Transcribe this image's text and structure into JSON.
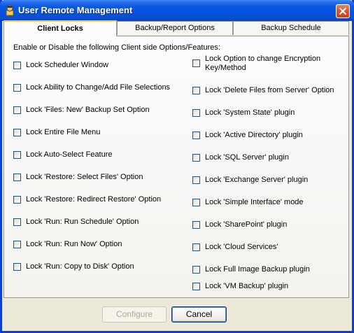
{
  "window": {
    "title": "User Remote Management",
    "app_icon": "app-icon",
    "close_icon": "close-icon"
  },
  "tabs": [
    {
      "label": "Client Locks",
      "active": true
    },
    {
      "label": "Backup/Report Options",
      "active": false
    },
    {
      "label": "Backup Schedule",
      "active": false
    }
  ],
  "panel": {
    "intro": "Enable or Disable the following Client side Options/Features:",
    "left_options": [
      {
        "label": "Lock Scheduler Window",
        "checked": false
      },
      {
        "label": "Lock Ability to Change/Add File Selections",
        "checked": false
      },
      {
        "label": "Lock 'Files: New' Backup Set Option",
        "checked": false
      },
      {
        "label": "Lock Entire File Menu",
        "checked": false
      },
      {
        "label": "Lock Auto-Select Feature",
        "checked": false
      },
      {
        "label": "Lock 'Restore: Select Files' Option",
        "checked": false
      },
      {
        "label": "Lock 'Restore: Redirect Restore' Option",
        "checked": false
      },
      {
        "label": "Lock 'Run: Run Schedule' Option",
        "checked": false
      },
      {
        "label": "Lock 'Run: Run Now' Option",
        "checked": false
      },
      {
        "label": "Lock 'Run: Copy to Disk' Option",
        "checked": false
      }
    ],
    "right_options": [
      {
        "label": "Lock Option to change Encryption",
        "label2": "Key/Method",
        "checked": false
      },
      {
        "label": "Lock 'Delete Files from Server' Option",
        "checked": false
      },
      {
        "label": "Lock 'System State' plugin",
        "checked": false
      },
      {
        "label": "Lock 'Active Directory' plugin",
        "checked": false
      },
      {
        "label": "Lock 'SQL Server' plugin",
        "checked": false
      },
      {
        "label": "Lock 'Exchange Server' plugin",
        "checked": false
      },
      {
        "label": "Lock 'Simple Interface' mode",
        "checked": false
      },
      {
        "label": "Lock 'SharePoint' plugin",
        "checked": false
      },
      {
        "label": "Lock 'Cloud Services'",
        "checked": false
      },
      {
        "label": "Lock Full Image Backup plugin",
        "checked": false
      },
      {
        "label": "Lock 'VM Backup' plugin",
        "checked": false
      }
    ]
  },
  "buttons": {
    "configure": {
      "label": "Configure",
      "enabled": false
    },
    "cancel": {
      "label": "Cancel",
      "enabled": true
    }
  },
  "colors": {
    "titlebar": "#0553df",
    "active_tab_accent": "#ffc83c",
    "close_button": "#d9572e"
  }
}
